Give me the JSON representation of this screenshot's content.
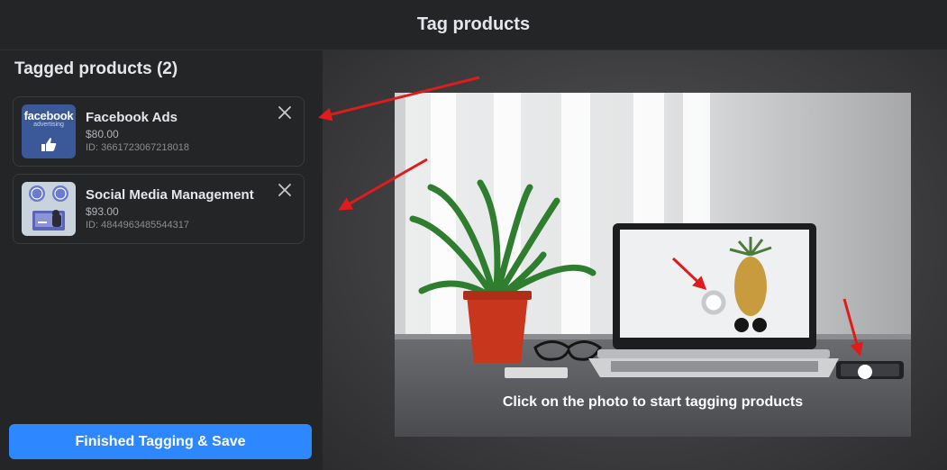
{
  "header": {
    "title": "Tag products"
  },
  "sidebar": {
    "title": "Tagged products (2)",
    "products": [
      {
        "name": "Facebook Ads",
        "price": "$80.00",
        "id": "ID: 3661723067218018",
        "thumb_icon": "facebook-advertising-logo",
        "thumb_word": "facebook",
        "thumb_sub": "advertising"
      },
      {
        "name": "Social Media Management",
        "price": "$93.00",
        "id": "ID: 4844963485544317",
        "thumb_icon": "social-media-management-illustration"
      }
    ],
    "save_label": "Finished Tagging & Save"
  },
  "canvas": {
    "hint": "Click on the photo to start tagging products",
    "tag_markers": [
      {
        "style": "ring"
      },
      {
        "style": "dot"
      }
    ]
  },
  "colors": {
    "accent": "#2d88ff",
    "background": "#242526",
    "annotation_arrow": "#e01b1b"
  }
}
